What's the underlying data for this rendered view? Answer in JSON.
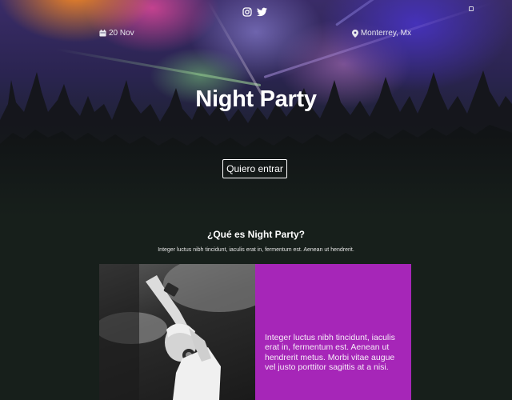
{
  "hero": {
    "date": "20 Nov",
    "location": "Monterrey, Mx",
    "title": "Night Party",
    "cta_label": "Quiero entrar"
  },
  "social_icons": [
    "instagram-icon",
    "twitter-icon"
  ],
  "about": {
    "title": "¿Qué es Night Party?",
    "text": "Integer luctus nibh tincidunt, iaculis erat in, fermentum est. Aenean ut hendrerit.",
    "panel_text": "Integer luctus nibh tincidunt, iaculis erat in, fermentum est. Aenean ut hendrerit metus. Morbi vitae augue vel justo porttitor sagittis at a nisi."
  },
  "colors": {
    "page_background": "#171f1b",
    "accent_purple": "#a626b8",
    "text": "#ffffff"
  }
}
